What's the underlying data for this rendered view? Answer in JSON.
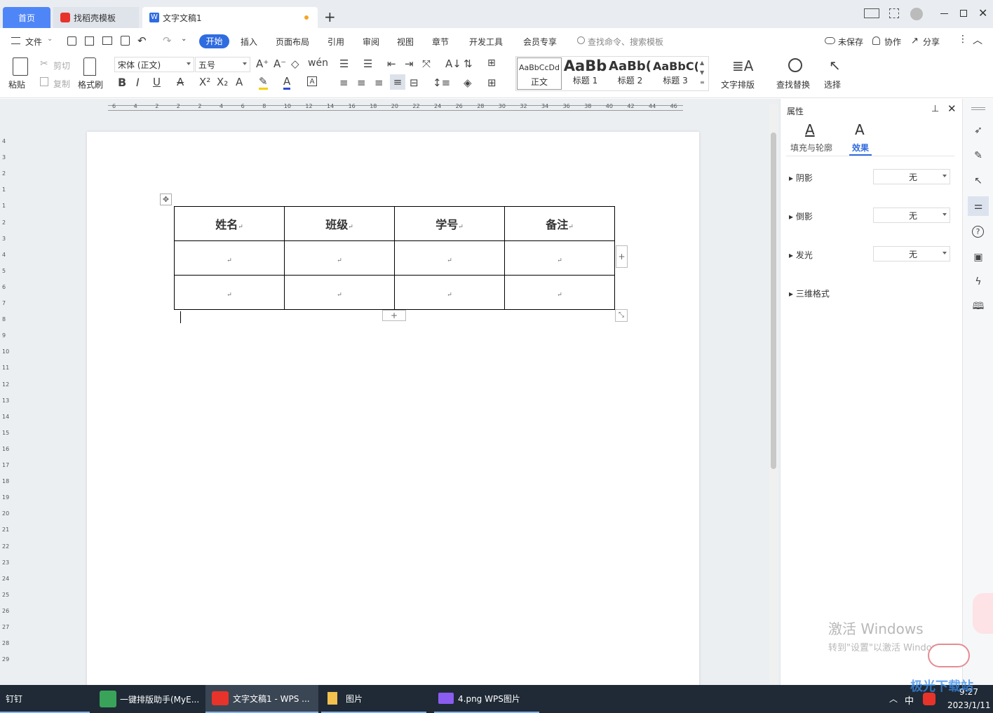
{
  "tabs": {
    "home": "首页",
    "template": "找稻壳模板",
    "doc": "文字文稿1",
    "add": "+"
  },
  "menu": {
    "file": "文件",
    "items": [
      "开始",
      "插入",
      "页面布局",
      "引用",
      "审阅",
      "视图",
      "章节",
      "开发工具",
      "会员专享"
    ],
    "search_placeholder": "查找命令、搜索模板",
    "unsaved": "未保存",
    "collab": "协作",
    "share": "分享"
  },
  "ribbon": {
    "paste": "粘贴",
    "cut": "剪切",
    "copy": "复制",
    "format_painter": "格式刷",
    "font": "宋体 (正文)",
    "size": "五号",
    "styles": [
      {
        "preview": "AaBbCcDd",
        "label": "正文"
      },
      {
        "preview": "AaBb",
        "label": "标题 1"
      },
      {
        "preview": "AaBb(",
        "label": "标题 2"
      },
      {
        "preview": "AaBbC(",
        "label": "标题 3"
      }
    ],
    "text_layout": "文字排版",
    "find_replace": "查找替换",
    "select": "选择"
  },
  "ruler": {
    "h": [
      "6",
      "4",
      "2",
      "2",
      "2",
      "4",
      "6",
      "8",
      "10",
      "12",
      "14",
      "16",
      "18",
      "20",
      "22",
      "24",
      "26",
      "28",
      "30",
      "32",
      "34",
      "36",
      "38",
      "40",
      "42",
      "44",
      "46"
    ],
    "v": [
      "4",
      "3",
      "2",
      "1",
      "1",
      "2",
      "3",
      "4",
      "5",
      "6",
      "7",
      "8",
      "9",
      "10",
      "11",
      "12",
      "13",
      "14",
      "15",
      "16",
      "17",
      "18",
      "19",
      "20",
      "21",
      "22",
      "23",
      "24",
      "25",
      "26",
      "27",
      "28",
      "29"
    ]
  },
  "table": {
    "headers": [
      "姓名",
      "班级",
      "学号",
      "备注"
    ],
    "mark": "↵"
  },
  "props": {
    "title": "属性",
    "tab_fill": "填充与轮廓",
    "tab_effect": "效果",
    "rows": [
      {
        "label": "阴影",
        "value": "无"
      },
      {
        "label": "倒影",
        "value": "无"
      },
      {
        "label": "发光",
        "value": "无"
      },
      {
        "label": "三维格式",
        "value": ""
      }
    ]
  },
  "watermark": {
    "line1": "激活 Windows",
    "line2": "转到\"设置\"以激活 Windows。"
  },
  "taskbar": {
    "items": [
      "钉钉",
      "一键排版助手(MyE...",
      "文字文稿1 - WPS ...",
      "图片",
      "4.png  WPS图片"
    ],
    "ime": "中",
    "time": "9:27",
    "date": "2023/1/11",
    "brand": "极光下载站"
  },
  "colors": {
    "accent": "#2f6ce0",
    "tab_home": "#4f86f7",
    "wps_red": "#e8332a",
    "taskbar": "#1f2a36"
  }
}
